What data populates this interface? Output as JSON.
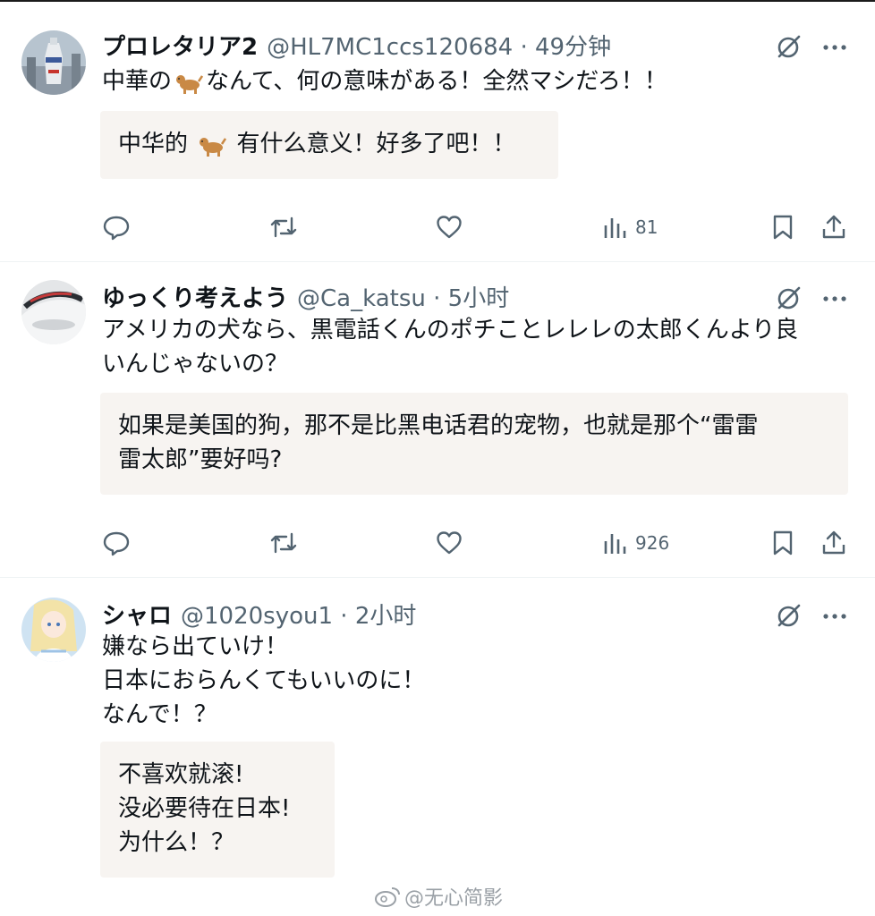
{
  "tweets": [
    {
      "name": "プロレタリア2",
      "meta": "@HL7MC1ccs120684 · 49分钟",
      "text_before_emoji": "中華の",
      "text_after_emoji": "なんて、何の意味がある！全然マシだろ！！",
      "translation_before_emoji": "中华的",
      "translation_after_emoji": "有什么意义！好多了吧！！",
      "views": "81"
    },
    {
      "name": "ゆっくり考えよう",
      "meta": "@Ca_katsu · 5小时",
      "lines": [
        "アメリカの犬なら、黒電話くんのポチことレレレの太郎くんより良",
        "いんじゃないの？"
      ],
      "translation": [
        "如果是美国的狗，那不是比黑电话君的宠物，也就是那个“雷雷",
        "雷太郎”要好吗?"
      ],
      "views": "926"
    },
    {
      "name": "シャロ",
      "meta": "@1020syou1 · 2小时",
      "lines": [
        "嫌なら出ていけ！",
        "日本におらんくてもいいのに！",
        "なんで！？"
      ],
      "translation": [
        "不喜欢就滚!",
        "没必要待在日本!",
        "为什么！？"
      ]
    }
  ],
  "watermark": "@无心简影",
  "icons": {
    "reply": "reply-icon",
    "retweet": "retweet-icon",
    "like": "heart-icon",
    "views": "views-icon",
    "bookmark": "bookmark-icon",
    "share": "share-icon",
    "grok": "grok-icon",
    "more": "more-icon"
  },
  "colors": {
    "text": "#0f1419",
    "secondary": "#536471",
    "translation_bg": "#f7f4f1"
  }
}
